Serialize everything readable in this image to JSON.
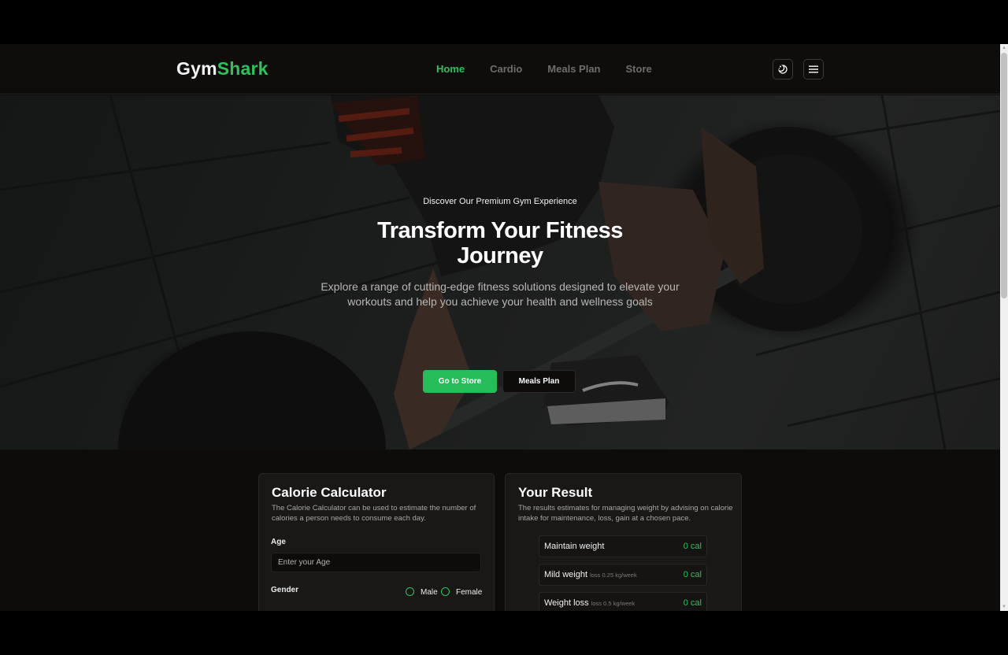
{
  "brand": {
    "part1": "Gym",
    "part2": "Shark"
  },
  "nav": {
    "items": [
      {
        "label": "Home",
        "active": true
      },
      {
        "label": "Cardio",
        "active": false
      },
      {
        "label": "Meals Plan",
        "active": false
      },
      {
        "label": "Store",
        "active": false
      }
    ],
    "theme_icon": "theme-toggle-icon",
    "menu_icon": "hamburger-menu-icon"
  },
  "hero": {
    "kicker": "Discover Our Premium Gym Experience",
    "title": "Transform Your Fitness Journey",
    "subtitle": "Explore a range of cutting-edge fitness solutions designed to elevate your workouts and help you achieve your health and wellness goals",
    "primary_button": "Go to Store",
    "secondary_button": "Meals Plan"
  },
  "calculator": {
    "title": "Calorie Calculator",
    "description": "The Calorie Calculator can be used to estimate the number of calories a person needs to consume each day.",
    "age_label": "Age",
    "age_placeholder": "Enter your Age",
    "gender_label": "Gender",
    "gender_options": [
      "Male",
      "Female"
    ]
  },
  "result": {
    "title": "Your Result",
    "description": "The results estimates for managing weight by advising on calorie intake for maintenance, loss, gain at a chosen pace.",
    "rows": [
      {
        "name": "Maintain weight",
        "note": "",
        "value": "0 cal"
      },
      {
        "name": "Mild weight",
        "note": "loss 0.25 kg/week",
        "value": "0 cal"
      },
      {
        "name": "Weight loss",
        "note": "loss 0.5 kg/week",
        "value": "0 cal"
      }
    ]
  },
  "colors": {
    "accent": "#2ec15c",
    "background": "#0e0c0b",
    "card": "#1a1817"
  }
}
